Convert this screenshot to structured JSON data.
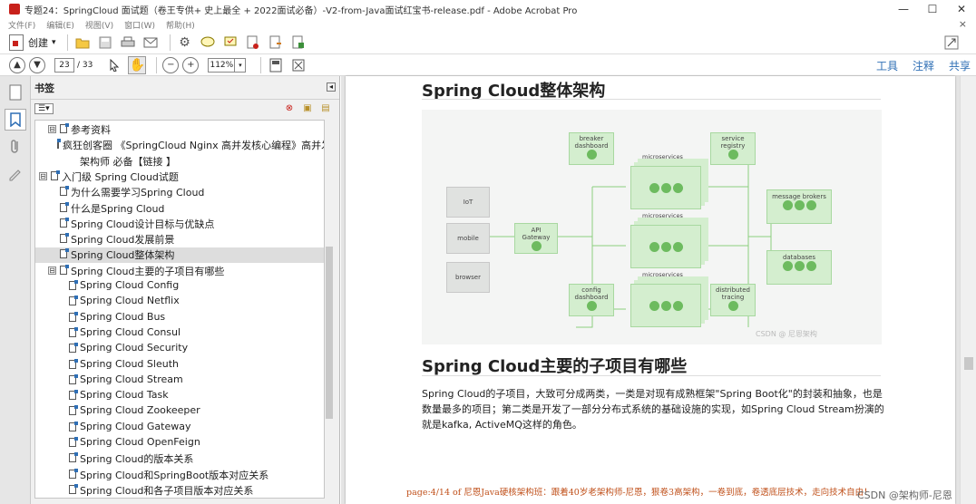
{
  "window": {
    "title": "专题24：SpringCloud 面试题（卷王专供+ 史上最全 + 2022面试必备）-V2-from-Java面试红宝书-release.pdf - Adobe Acrobat Pro",
    "min": "—",
    "max": "☐",
    "close": "✕"
  },
  "menu": {
    "items": [
      "文件(F)",
      "编辑(E)",
      "视图(V)",
      "窗口(W)",
      "帮助(H)"
    ],
    "close": "×"
  },
  "toolbar": {
    "create_label": "创建",
    "create_arrow": "▾"
  },
  "nav": {
    "current_page": "23",
    "total_pages": "/ 33",
    "zoom": "112%",
    "zoom_arrow": "▾",
    "tools_label": "工具",
    "comment_label": "注释",
    "share_label": "共享"
  },
  "bookmarks": {
    "header": "书签",
    "options_label": "☰▾",
    "items": [
      {
        "text": "参考资料",
        "level": 1,
        "expand": "⊟"
      },
      {
        "text": "疯狂创客圈 《SpringCloud Nginx 高并发核心编程》高并发",
        "level": 2,
        "expand": ""
      },
      {
        "text": "架构师 必备【链接 】",
        "level": 2,
        "expand": "",
        "continuation": true
      },
      {
        "text": "入门级 Spring Cloud试题",
        "level": 0,
        "expand": "⊟"
      },
      {
        "text": "为什么需要学习Spring Cloud",
        "level": 1,
        "expand": ""
      },
      {
        "text": "什么是Spring Cloud",
        "level": 1,
        "expand": ""
      },
      {
        "text": "Spring Cloud设计目标与优缺点",
        "level": 1,
        "expand": ""
      },
      {
        "text": "Spring Cloud发展前景",
        "level": 1,
        "expand": ""
      },
      {
        "text": "Spring Cloud整体架构",
        "level": 1,
        "expand": "",
        "selected": true
      },
      {
        "text": "Spring Cloud主要的子项目有哪些",
        "level": 1,
        "expand": "⊟"
      },
      {
        "text": "Spring Cloud Config",
        "level": 2,
        "expand": ""
      },
      {
        "text": "Spring Cloud Netflix",
        "level": 2,
        "expand": ""
      },
      {
        "text": "Spring Cloud Bus",
        "level": 2,
        "expand": ""
      },
      {
        "text": "Spring Cloud Consul",
        "level": 2,
        "expand": ""
      },
      {
        "text": "Spring Cloud Security",
        "level": 2,
        "expand": ""
      },
      {
        "text": "Spring Cloud Sleuth",
        "level": 2,
        "expand": ""
      },
      {
        "text": "Spring Cloud Stream",
        "level": 2,
        "expand": ""
      },
      {
        "text": "Spring Cloud Task",
        "level": 2,
        "expand": ""
      },
      {
        "text": "Spring Cloud Zookeeper",
        "level": 2,
        "expand": ""
      },
      {
        "text": "Spring Cloud Gateway",
        "level": 2,
        "expand": ""
      },
      {
        "text": "Spring Cloud OpenFeign",
        "level": 2,
        "expand": ""
      },
      {
        "text": "Spring Cloud的版本关系",
        "level": 2,
        "expand": ""
      },
      {
        "text": "Spring Cloud和SpringBoot版本对应关系",
        "level": 2,
        "expand": ""
      },
      {
        "text": "Spring Cloud和各子项目版本对应关系",
        "level": 2,
        "expand": ""
      }
    ]
  },
  "document": {
    "heading1": "Spring Cloud整体架构",
    "heading2": "Spring Cloud主要的子项目有哪些",
    "paragraph": "Spring Cloud的子项目，大致可分成两类，一类是对现有成熟框架\"Spring Boot化\"的封装和抽象，也是数量最多的项目；第二类是开发了一部分分布式系统的基础设施的实现，如Spring Cloud Stream扮演的就是kafka, ActiveMQ这样的角色。",
    "footer": "page:4/14 of   尼恩Java硬核架构班：跟着40岁老架构师-尼恩，狠卷3高架构，一卷到底，卷透底层技术，走向技术自由！",
    "watermark": "CSDN @架构师-尼恩",
    "diagram": {
      "iot": "IoT",
      "mobile": "mobile",
      "browser": "browser",
      "api_gateway_1": "API",
      "api_gateway_2": "Gateway",
      "breaker_1": "breaker",
      "breaker_2": "dashboard",
      "registry_1": "service",
      "registry_2": "registry",
      "microservices": "microservices",
      "config_1": "config",
      "config_2": "dashboard",
      "tracing_1": "distributed",
      "tracing_2": "tracing",
      "brokers": "message brokers",
      "databases": "databases",
      "image_watermark": "CSDN @ 尼恩架构"
    }
  },
  "colors": {
    "accent": "#2f6fb5",
    "footer": "#c0501a",
    "diagram_green": "#6dbb5f"
  }
}
